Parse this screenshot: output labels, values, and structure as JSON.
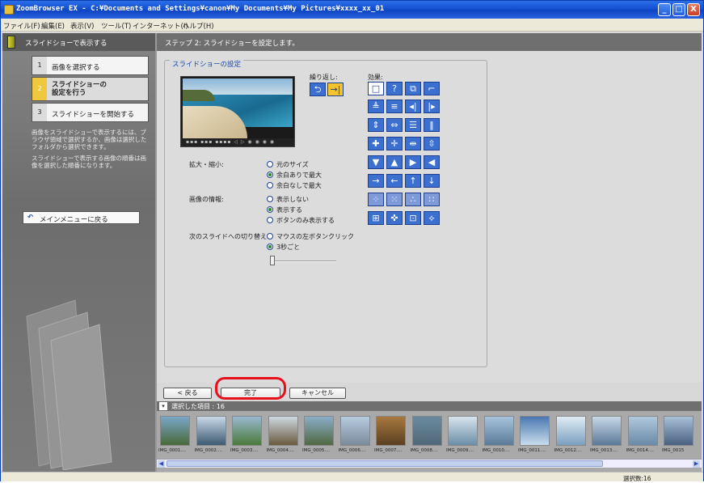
{
  "window": {
    "title": "ZoomBrowser EX  -  C:¥Documents and Settings¥canon¥My Documents¥My Pictures¥xxxx_xx_01",
    "buttons": [
      "_",
      "□",
      "X"
    ]
  },
  "menu": [
    "ファイル(F)",
    "編集(E)",
    "表示(V)",
    "ツール(T)",
    "インターネット(I)",
    "ヘルプ(H)"
  ],
  "sidebar": {
    "header": "スライドショーで表示する",
    "steps": [
      {
        "num": "1",
        "label": "画像を選択する"
      },
      {
        "num": "2",
        "label": "スライドショーの\n設定を行う"
      },
      {
        "num": "3",
        "label": "スライドショーを開始する"
      }
    ],
    "help1": "画像をスライドショーで表示するには、ブラウザ領域で選択するか、画像は選択したフォルダから選択できます。",
    "help2": "スライドショーで表示する画像の順番は画像を選択した順番になります。",
    "back_label": "メインメニューに戻る"
  },
  "main": {
    "step_header": "ステップ 2: スライドショーを設定します。",
    "group_title": "スライドショーの設定",
    "repeat_label": "繰り返し:",
    "effect_label": "効果:",
    "zoom_label": "拡大・縮小:",
    "zoom_options": [
      "元のサイズ",
      "余白ありで最大",
      "余白なしで最大"
    ],
    "zoom_selected": 1,
    "info_label": "画像の情報:",
    "info_options": [
      "表示しない",
      "表示する",
      "ボタンのみ表示する"
    ],
    "info_selected": 1,
    "next_label": "次のスライドへの切り替え:",
    "next_options": [
      "マウスの左ボタンクリック",
      "3秒ごと"
    ],
    "next_selected": 1,
    "interval_seconds": 3
  },
  "buttons": {
    "back": "< 戻る",
    "finish": "完了",
    "cancel": "キャンセル"
  },
  "strip": {
    "title": "選択した項目 : 16",
    "thumbs": [
      "IMG_0001....",
      "IMG_0002....",
      "IMG_0003....",
      "IMG_0004....",
      "IMG_0005....",
      "IMG_0006....",
      "IMG_0007....",
      "IMG_0008....",
      "IMG_0009....",
      "IMG_0010....",
      "IMG_0011....",
      "IMG_0012....",
      "IMG_0013....",
      "IMG_0014....",
      "IMG_0015"
    ]
  },
  "status": {
    "selected": "選択数:16"
  },
  "colors": {
    "accent": "#e8101a",
    "title_blue": "#1a4bb0",
    "effect_blue": "#3b6fd0",
    "step_active": "#f0c840"
  }
}
